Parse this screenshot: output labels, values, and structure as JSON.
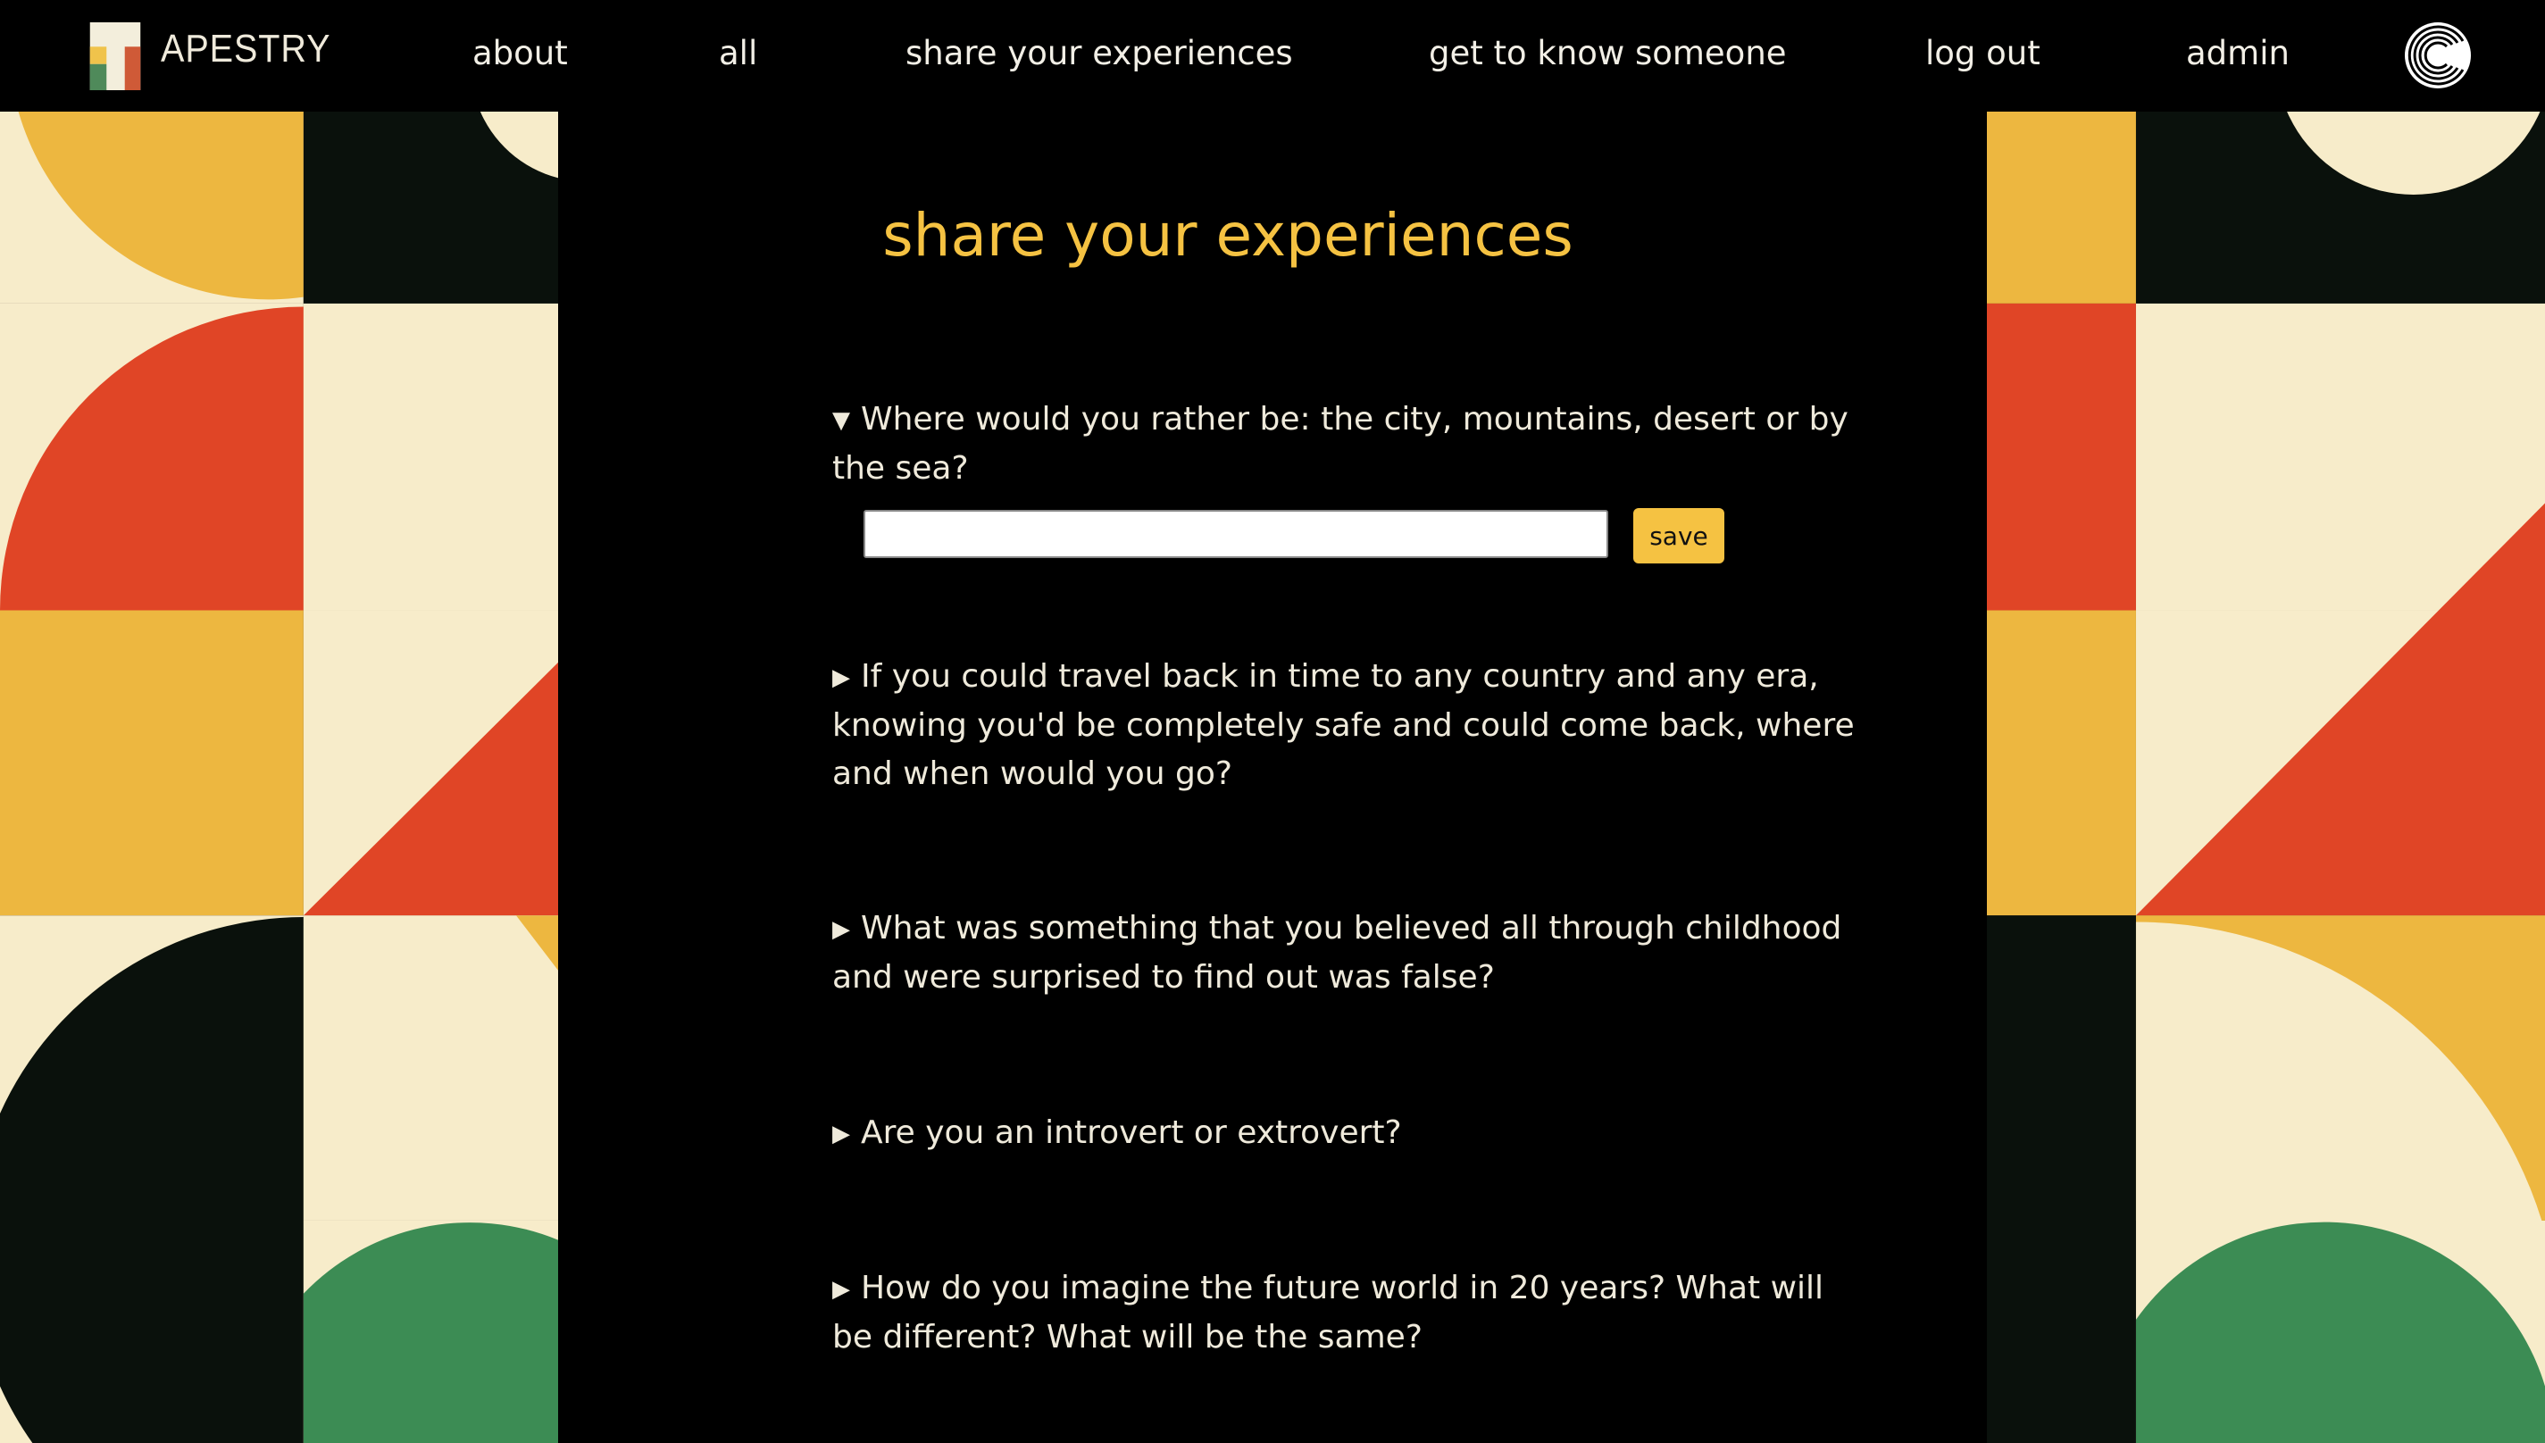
{
  "nav": {
    "logo_text": "APESTRY",
    "items": [
      {
        "label": "about"
      },
      {
        "label": "all"
      },
      {
        "label": "share your experiences"
      },
      {
        "label": "get to know someone"
      },
      {
        "label": "log out"
      },
      {
        "label": "admin"
      }
    ],
    "user_icon": "concentric-c-logo-icon"
  },
  "main": {
    "title": "share your experiences",
    "questions": [
      {
        "text": "Where would you rather be: the city, mountains, desert or by the sea?",
        "expanded": true,
        "triangle": "▼"
      },
      {
        "text": "If you could travel back in time to any country and any era, knowing you'd be completely safe and could come back, where and when would you go?",
        "expanded": false,
        "triangle": "▶"
      },
      {
        "text": "What was something that you believed all through childhood and were surprised to find out was false?",
        "expanded": false,
        "triangle": "▶"
      },
      {
        "text": "Are you an introvert or extrovert?",
        "expanded": false,
        "triangle": "▶"
      },
      {
        "text": "How do you imagine the future world in 20 years? What will be different? What will be the same?",
        "expanded": false,
        "triangle": "▶"
      }
    ],
    "answer_value": "",
    "save_label": "save"
  },
  "colors": {
    "accent": "#f5c242",
    "red": "#e04526",
    "cream": "#f7ecca",
    "dark": "#0a110c",
    "green": "#3c8c54",
    "yellow": "#edb740"
  }
}
